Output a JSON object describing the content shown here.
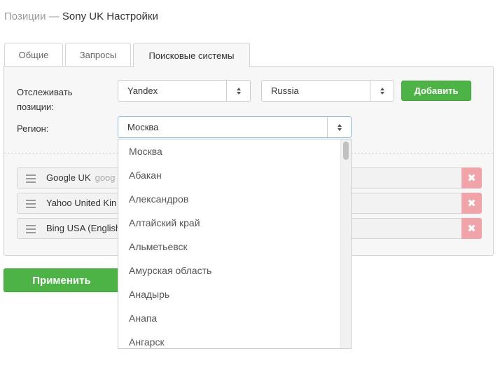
{
  "header": {
    "prefix": "Позиции — ",
    "title": "Sony UK Настройки"
  },
  "tabs": [
    {
      "label": "Общие",
      "active": false
    },
    {
      "label": "Запросы",
      "active": false
    },
    {
      "label": "Поисковые системы",
      "active": true
    }
  ],
  "form": {
    "track_label_line1": "Отслеживать",
    "track_label_line2": "позиции:",
    "engine_select": "Yandex",
    "country_select": "Russia",
    "add_button": "Добавить",
    "region_label": "Регион:",
    "region_select": "Москва"
  },
  "engines": [
    {
      "name": "Google UK",
      "host": "goog"
    },
    {
      "name": "Yahoo United Kin",
      "host": ""
    },
    {
      "name": "Bing USA (English",
      "host": ""
    }
  ],
  "delete_glyph": "✖",
  "apply_button": "Применить",
  "region_options": [
    "Москва",
    "Абакан",
    "Александров",
    "Алтайский край",
    "Альметьевск",
    "Амурская область",
    "Анадырь",
    "Анапа",
    "Ангарск"
  ],
  "colors": {
    "accent_green": "#4db347",
    "delete_pink": "#f0a3a8",
    "panel_bg": "#f7f7f7"
  }
}
